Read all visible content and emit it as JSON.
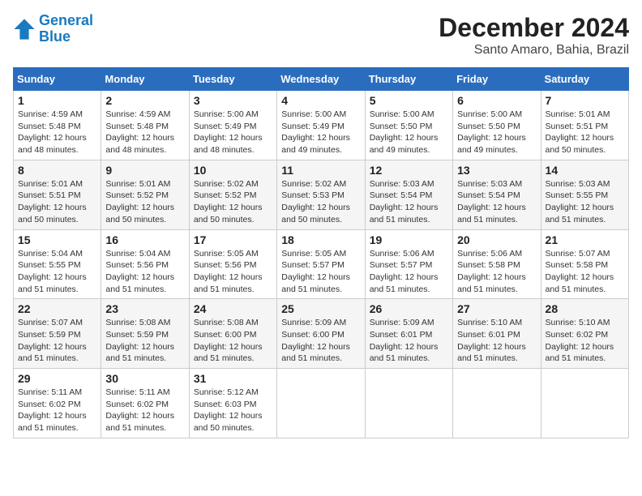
{
  "header": {
    "logo_line1": "General",
    "logo_line2": "Blue",
    "month": "December 2024",
    "location": "Santo Amaro, Bahia, Brazil"
  },
  "days_of_week": [
    "Sunday",
    "Monday",
    "Tuesday",
    "Wednesday",
    "Thursday",
    "Friday",
    "Saturday"
  ],
  "weeks": [
    [
      {
        "day": "1",
        "sunrise": "4:59 AM",
        "sunset": "5:48 PM",
        "daylight": "12 hours and 48 minutes."
      },
      {
        "day": "2",
        "sunrise": "4:59 AM",
        "sunset": "5:48 PM",
        "daylight": "12 hours and 48 minutes."
      },
      {
        "day": "3",
        "sunrise": "5:00 AM",
        "sunset": "5:49 PM",
        "daylight": "12 hours and 48 minutes."
      },
      {
        "day": "4",
        "sunrise": "5:00 AM",
        "sunset": "5:49 PM",
        "daylight": "12 hours and 49 minutes."
      },
      {
        "day": "5",
        "sunrise": "5:00 AM",
        "sunset": "5:50 PM",
        "daylight": "12 hours and 49 minutes."
      },
      {
        "day": "6",
        "sunrise": "5:00 AM",
        "sunset": "5:50 PM",
        "daylight": "12 hours and 49 minutes."
      },
      {
        "day": "7",
        "sunrise": "5:01 AM",
        "sunset": "5:51 PM",
        "daylight": "12 hours and 50 minutes."
      }
    ],
    [
      {
        "day": "8",
        "sunrise": "5:01 AM",
        "sunset": "5:51 PM",
        "daylight": "12 hours and 50 minutes."
      },
      {
        "day": "9",
        "sunrise": "5:01 AM",
        "sunset": "5:52 PM",
        "daylight": "12 hours and 50 minutes."
      },
      {
        "day": "10",
        "sunrise": "5:02 AM",
        "sunset": "5:52 PM",
        "daylight": "12 hours and 50 minutes."
      },
      {
        "day": "11",
        "sunrise": "5:02 AM",
        "sunset": "5:53 PM",
        "daylight": "12 hours and 50 minutes."
      },
      {
        "day": "12",
        "sunrise": "5:03 AM",
        "sunset": "5:54 PM",
        "daylight": "12 hours and 51 minutes."
      },
      {
        "day": "13",
        "sunrise": "5:03 AM",
        "sunset": "5:54 PM",
        "daylight": "12 hours and 51 minutes."
      },
      {
        "day": "14",
        "sunrise": "5:03 AM",
        "sunset": "5:55 PM",
        "daylight": "12 hours and 51 minutes."
      }
    ],
    [
      {
        "day": "15",
        "sunrise": "5:04 AM",
        "sunset": "5:55 PM",
        "daylight": "12 hours and 51 minutes."
      },
      {
        "day": "16",
        "sunrise": "5:04 AM",
        "sunset": "5:56 PM",
        "daylight": "12 hours and 51 minutes."
      },
      {
        "day": "17",
        "sunrise": "5:05 AM",
        "sunset": "5:56 PM",
        "daylight": "12 hours and 51 minutes."
      },
      {
        "day": "18",
        "sunrise": "5:05 AM",
        "sunset": "5:57 PM",
        "daylight": "12 hours and 51 minutes."
      },
      {
        "day": "19",
        "sunrise": "5:06 AM",
        "sunset": "5:57 PM",
        "daylight": "12 hours and 51 minutes."
      },
      {
        "day": "20",
        "sunrise": "5:06 AM",
        "sunset": "5:58 PM",
        "daylight": "12 hours and 51 minutes."
      },
      {
        "day": "21",
        "sunrise": "5:07 AM",
        "sunset": "5:58 PM",
        "daylight": "12 hours and 51 minutes."
      }
    ],
    [
      {
        "day": "22",
        "sunrise": "5:07 AM",
        "sunset": "5:59 PM",
        "daylight": "12 hours and 51 minutes."
      },
      {
        "day": "23",
        "sunrise": "5:08 AM",
        "sunset": "5:59 PM",
        "daylight": "12 hours and 51 minutes."
      },
      {
        "day": "24",
        "sunrise": "5:08 AM",
        "sunset": "6:00 PM",
        "daylight": "12 hours and 51 minutes."
      },
      {
        "day": "25",
        "sunrise": "5:09 AM",
        "sunset": "6:00 PM",
        "daylight": "12 hours and 51 minutes."
      },
      {
        "day": "26",
        "sunrise": "5:09 AM",
        "sunset": "6:01 PM",
        "daylight": "12 hours and 51 minutes."
      },
      {
        "day": "27",
        "sunrise": "5:10 AM",
        "sunset": "6:01 PM",
        "daylight": "12 hours and 51 minutes."
      },
      {
        "day": "28",
        "sunrise": "5:10 AM",
        "sunset": "6:02 PM",
        "daylight": "12 hours and 51 minutes."
      }
    ],
    [
      {
        "day": "29",
        "sunrise": "5:11 AM",
        "sunset": "6:02 PM",
        "daylight": "12 hours and 51 minutes."
      },
      {
        "day": "30",
        "sunrise": "5:11 AM",
        "sunset": "6:02 PM",
        "daylight": "12 hours and 51 minutes."
      },
      {
        "day": "31",
        "sunrise": "5:12 AM",
        "sunset": "6:03 PM",
        "daylight": "12 hours and 50 minutes."
      },
      null,
      null,
      null,
      null
    ]
  ]
}
